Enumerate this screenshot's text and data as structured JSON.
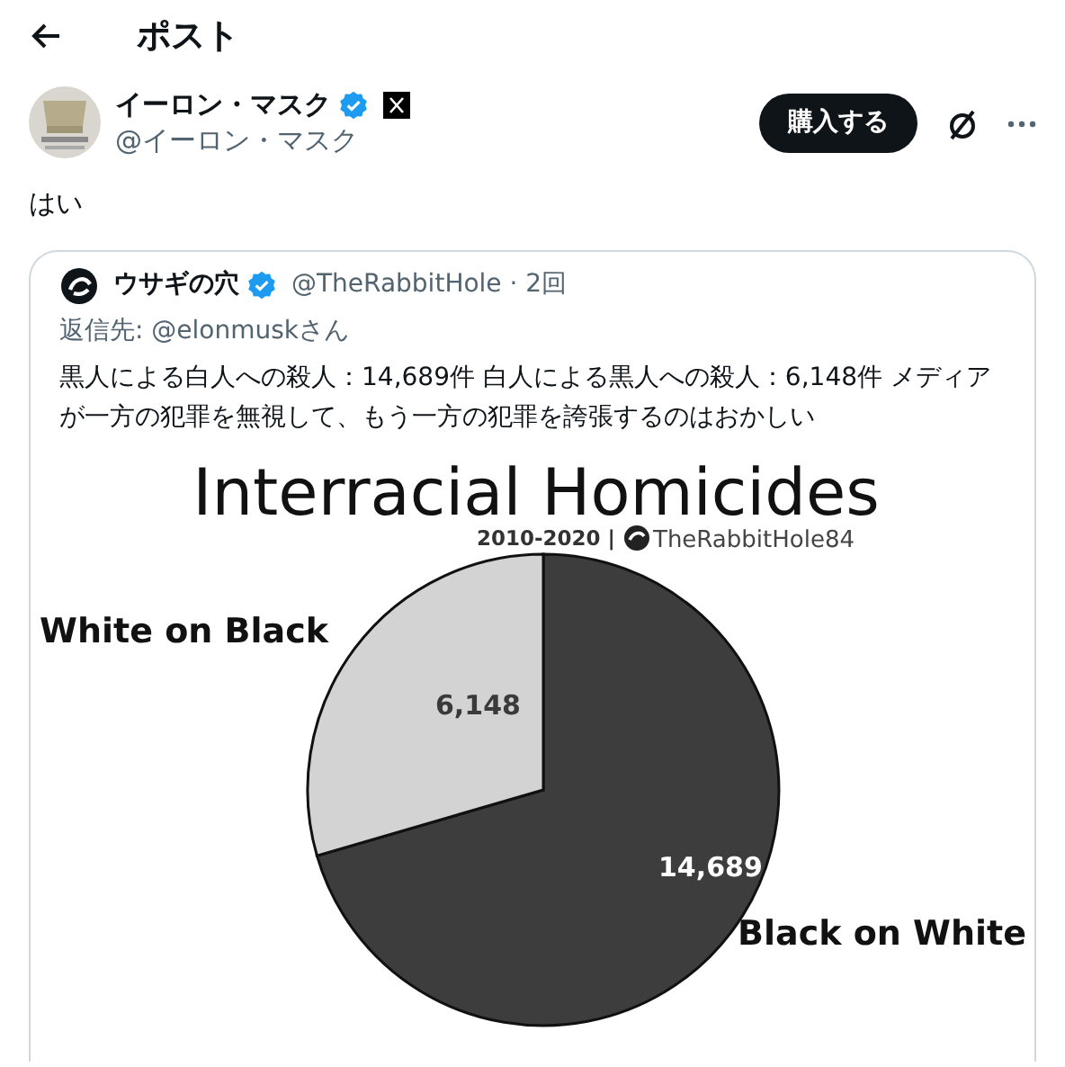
{
  "header": {
    "title": "ポスト"
  },
  "post": {
    "author": {
      "name": "イーロン・マスク",
      "handle": "@イーロン・マスク",
      "verified": true
    },
    "buy_button": "購入する",
    "text": "はい",
    "quote": {
      "author": {
        "name": "ウサギの穴",
        "meta": "@TheRabbitHole · 2回",
        "verified": true
      },
      "reply_to": "返信先: @elonmuskさん",
      "text": "黒人による白人への殺人：14,689件 白人による黒人への殺人：6,148件 メディアが一方の犯罪を無視して、もう一方の犯罪を誇張するのはおかしい",
      "media": {
        "credit": {
          "period": "2010-2020 |",
          "source": "TheRabbitHole84"
        },
        "chart_data": {
          "type": "pie",
          "title": "Interracial Homicides",
          "categories": [
            "Black on White",
            "White on Black"
          ],
          "values": [
            14689,
            6148
          ],
          "colors": [
            "#3d3d3d",
            "#d3d3d3"
          ],
          "value_labels": [
            "14,689",
            "6,148"
          ]
        }
      }
    }
  }
}
